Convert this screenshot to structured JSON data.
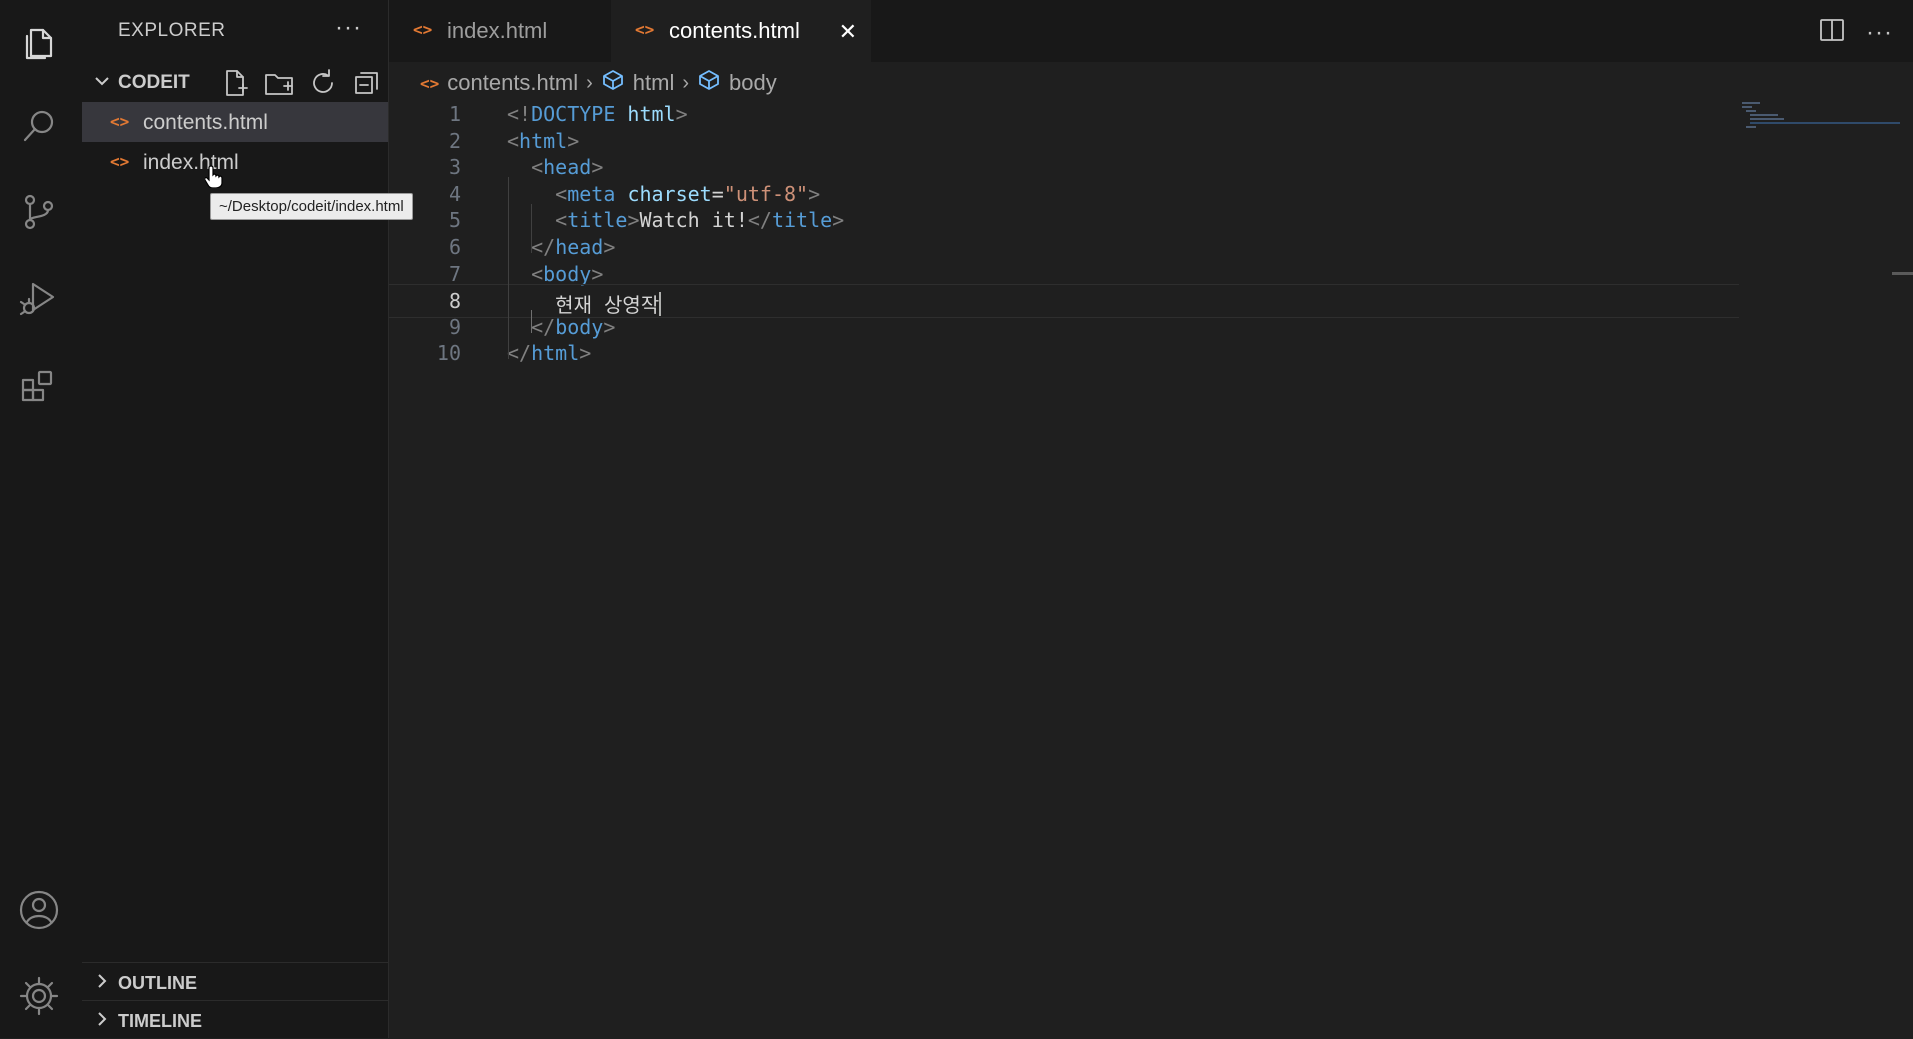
{
  "sidebar": {
    "title": "EXPLORER",
    "more": "···",
    "folder": "CODEIT",
    "files": [
      {
        "icon": "<>",
        "name": "contents.html"
      },
      {
        "icon": "<>",
        "name": "index.html"
      }
    ],
    "tooltip": "~/Desktop/codeit/index.html",
    "panels": [
      "OUTLINE",
      "TIMELINE"
    ]
  },
  "tabs": [
    {
      "icon": "<>",
      "label": "index.html"
    },
    {
      "icon": "<>",
      "label": "contents.html",
      "close": "✕"
    }
  ],
  "more_actions": "···",
  "breadcrumb": {
    "file_icon": "<>",
    "file": "contents.html",
    "sep1": "›",
    "node1": "html",
    "sep2": "›",
    "node2": "body"
  },
  "editor": {
    "current_line": 8,
    "lines": [
      {
        "n": "1",
        "t": [
          [
            "<!",
            "p"
          ],
          [
            "DOCTYPE ",
            "tag"
          ],
          [
            "html",
            "attr"
          ],
          [
            ">",
            "p"
          ]
        ]
      },
      {
        "n": "2",
        "t": [
          [
            "<",
            "p"
          ],
          [
            "html",
            "tag"
          ],
          [
            ">",
            "p"
          ]
        ]
      },
      {
        "n": "3",
        "t": [
          [
            "  ",
            "txt"
          ],
          [
            "<",
            "p"
          ],
          [
            "head",
            "tag"
          ],
          [
            ">",
            "p"
          ]
        ]
      },
      {
        "n": "4",
        "t": [
          [
            "    ",
            "txt"
          ],
          [
            "<",
            "p"
          ],
          [
            "meta ",
            "tag"
          ],
          [
            "charset",
            "attr"
          ],
          [
            "=",
            "txt"
          ],
          [
            "\"utf-8\"",
            "str"
          ],
          [
            ">",
            "p"
          ]
        ]
      },
      {
        "n": "5",
        "t": [
          [
            "    ",
            "txt"
          ],
          [
            "<",
            "p"
          ],
          [
            "title",
            "tag"
          ],
          [
            ">",
            "p"
          ],
          [
            "Watch it!",
            "txt"
          ],
          [
            "</",
            "p"
          ],
          [
            "title",
            "tag"
          ],
          [
            ">",
            "p"
          ]
        ]
      },
      {
        "n": "6",
        "t": [
          [
            "  ",
            "txt"
          ],
          [
            "</",
            "p"
          ],
          [
            "head",
            "tag"
          ],
          [
            ">",
            "p"
          ]
        ]
      },
      {
        "n": "7",
        "t": [
          [
            "  ",
            "txt"
          ],
          [
            "<",
            "p"
          ],
          [
            "body",
            "tag"
          ],
          [
            ">",
            "p"
          ]
        ]
      },
      {
        "n": "8",
        "t": [
          [
            "    ",
            "txt"
          ],
          [
            "현재 상영작",
            "txt"
          ]
        ]
      },
      {
        "n": "9",
        "t": [
          [
            "  ",
            "txt"
          ],
          [
            "</",
            "p"
          ],
          [
            "body",
            "tag"
          ],
          [
            ">",
            "p"
          ]
        ]
      },
      {
        "n": "10",
        "t": [
          [
            "</",
            "p"
          ],
          [
            "html",
            "tag"
          ],
          [
            ">",
            "p"
          ]
        ]
      }
    ]
  },
  "colors": {
    "background": "#1f1f1f",
    "sidebar": "#181818",
    "tag": "#569cd6",
    "attribute": "#9cdcfe",
    "string": "#ce9178",
    "file_icon": "#e37933"
  },
  "icons": {
    "activity": [
      "files-icon",
      "search-icon",
      "source-control-icon",
      "run-debug-icon",
      "extensions-icon",
      "account-icon",
      "settings-gear-icon"
    ],
    "folder_actions": [
      "new-file-icon",
      "new-folder-icon",
      "refresh-icon",
      "collapse-all-icon"
    ],
    "editor_actions": [
      "split-editor-icon"
    ]
  }
}
